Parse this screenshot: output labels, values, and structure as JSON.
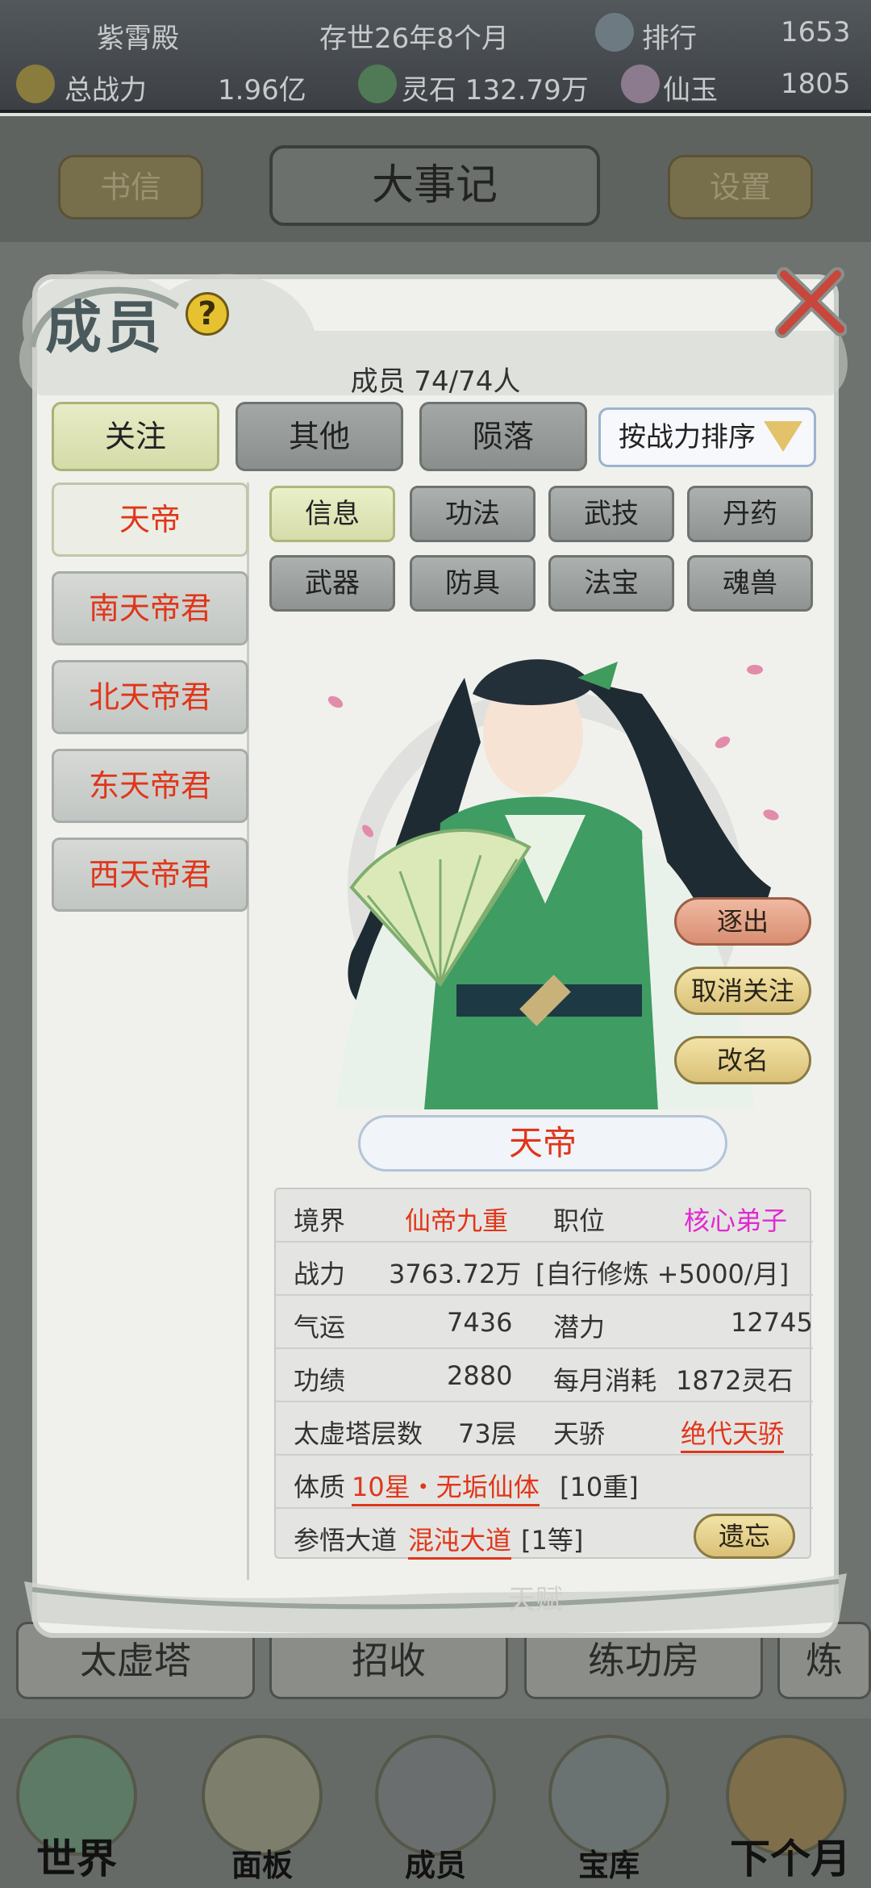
{
  "top_bar": {
    "sect_name": "紫霄殿",
    "time_text": "存世26年8个月",
    "rank_label": "排行",
    "rank_value": "1653",
    "power_label": "总战力",
    "power_value": "1.96亿",
    "spirit_stone": "灵石 132.79万",
    "jade_label": "仙玉",
    "jade_value": "1805"
  },
  "header": {
    "letters_label": "书信",
    "title": "大事记",
    "settings_label": "设置"
  },
  "bg_tabs": [
    "太虚塔",
    "招收",
    "练功房",
    "炼"
  ],
  "bottom_nav": [
    "世界",
    "面板",
    "成员",
    "宝库",
    "下个月"
  ],
  "modal": {
    "title": "成员",
    "help": "?",
    "member_count": "成员  74/74人",
    "category_tabs": [
      "关注",
      "其他",
      "陨落"
    ],
    "sort_label": "按战力排序",
    "members": [
      "天帝",
      "南天帝君",
      "北天帝君",
      "东天帝君",
      "西天帝君"
    ],
    "sub_tabs": [
      "信息",
      "功法",
      "武技",
      "丹药",
      "武器",
      "防具",
      "法宝",
      "魂兽"
    ],
    "actions": {
      "kick": "逐出",
      "unfollow": "取消关注",
      "rename": "改名",
      "forget": "遗忘"
    },
    "name": "天帝",
    "faded_label": "天赋"
  },
  "info": {
    "realm_label": "境界",
    "realm_value": "仙帝九重",
    "position_label": "职位",
    "position_value": "核心弟子",
    "power_label": "战力",
    "power_value": "3763.72万",
    "power_extra": "[自行修炼 +5000/月]",
    "luck_label": "气运",
    "luck_value": "7436",
    "potential_label": "潜力",
    "potential_value": "12745",
    "merit_label": "功绩",
    "merit_value": "2880",
    "monthly_label": "每月消耗",
    "monthly_value": "1872灵石",
    "tower_label": "太虚塔层数",
    "tower_value": "73层",
    "prodigy_label": "天骄",
    "prodigy_value": "绝代天骄",
    "constitution_label": "体质",
    "constitution_value": "10星・无垢仙体",
    "constitution_level": "[10重]",
    "dao_label": "参悟大道",
    "dao_value": "混沌大道",
    "dao_grade": "[1等]"
  },
  "colors": {
    "red_text": "#e0361a",
    "magenta_text": "#e02ad0",
    "button_gold": "#d9c077",
    "active_tab": "#d6dcaa"
  }
}
